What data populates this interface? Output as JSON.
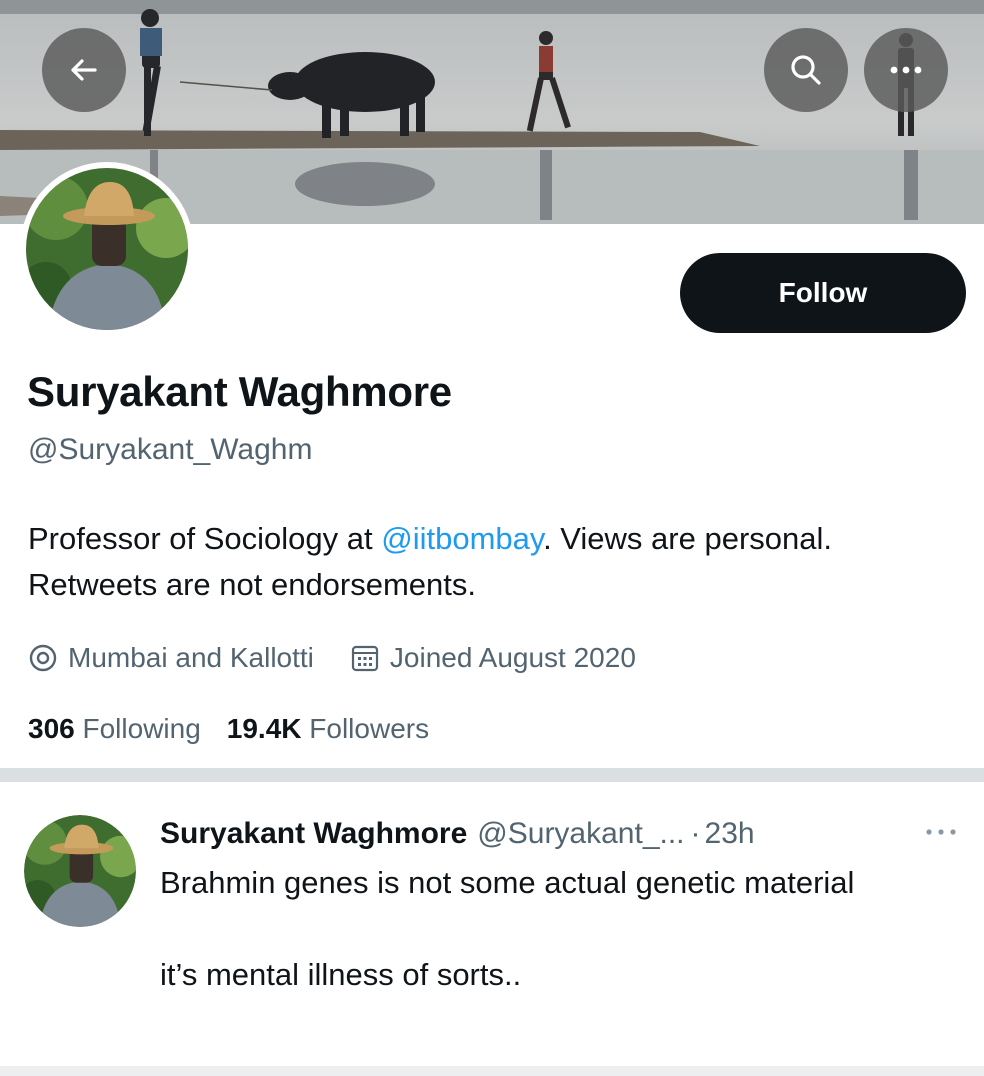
{
  "header": {
    "back_icon": "arrow-left-icon",
    "search_icon": "search-icon",
    "more_icon": "more-dots-icon"
  },
  "profile": {
    "display_name": "Suryakant Waghmore",
    "handle": "@Suryakant_Waghm",
    "follow_label": "Follow",
    "bio": {
      "part1": "Professor of Sociology at ",
      "mention": "@iitbombay",
      "part2": ". Views are personal. Retweets are not endorsements."
    },
    "location": "Mumbai and Kallotti",
    "joined": "Joined August 2020",
    "following_count": "306",
    "following_label": "Following",
    "followers_count": "19.4K",
    "followers_label": "Followers"
  },
  "tweet": {
    "author": "Suryakant Waghmore",
    "handle": "@Suryakant_...",
    "dot": "·",
    "time": "23h",
    "line1": "Brahmin genes is not some actual genetic material",
    "line2": "it’s mental illness of sorts.."
  },
  "colors": {
    "accent_link": "#1d9bf0",
    "follow_bg": "#0f1419",
    "secondary_text": "#536471"
  }
}
